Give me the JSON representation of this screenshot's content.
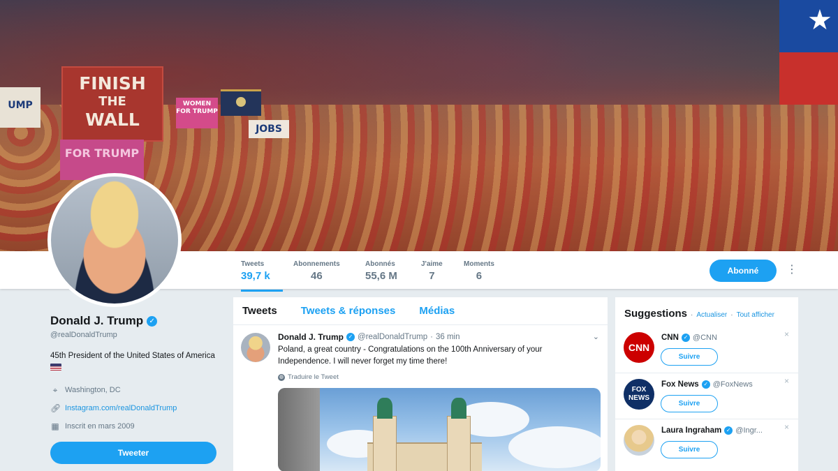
{
  "banner": {
    "sign_wall_line1": "FINISH",
    "sign_wall_line2": "THE",
    "sign_wall_line3": "WALL",
    "sign_women": "WOMEN FOR TRUMP",
    "sign_trump_left": "UMP",
    "sign_pink": "FOR TRUMP",
    "sign_jobs": "JOBS"
  },
  "navbar": {
    "stats": [
      {
        "label": "Tweets",
        "value": "39,7 k"
      },
      {
        "label": "Abonnements",
        "value": "46"
      },
      {
        "label": "Abonnés",
        "value": "55,6 M"
      },
      {
        "label": "J'aime",
        "value": "7"
      },
      {
        "label": "Moments",
        "value": "6"
      }
    ],
    "follow_label": "Abonné",
    "more_icon": "⋮"
  },
  "profile": {
    "name": "Donald J. Trump",
    "handle": "@realDonaldTrump",
    "bio": "45th President of the United States of America",
    "location": "Washington, DC",
    "website": "Instagram.com/realDonaldTrump",
    "joined": "Inscrit en mars 2009",
    "tweet_button": "Tweeter"
  },
  "timeline": {
    "tabs": [
      "Tweets",
      "Tweets & réponses",
      "Médias"
    ],
    "tweet": {
      "name": "Donald J. Trump",
      "handle": "@realDonaldTrump",
      "sep": "·",
      "time": "36 min",
      "text": "Poland, a great country - Congratulations on the 100th Anniversary of your Independence. I will never forget my time there!",
      "translate": "Traduire le Tweet",
      "caret": "⌄"
    }
  },
  "suggestions": {
    "title": "Suggestions",
    "dot": "·",
    "refresh": "Actualiser",
    "view_all": "Tout afficher",
    "follow_label": "Suivre",
    "close": "×",
    "items": [
      {
        "name": "CNN",
        "handle": "@CNN",
        "logo": "CNN",
        "color": "#cc0000"
      },
      {
        "name": "Fox News",
        "handle": "@FoxNews",
        "logo": "FOX NEWS",
        "color": "#0f2f66"
      },
      {
        "name": "Laura Ingraham",
        "handle": "@Ingr...",
        "logo": "",
        "color": "#e8d7b8"
      }
    ]
  },
  "colors": {
    "accent": "#1da1f2",
    "background": "#e6ecf0"
  }
}
